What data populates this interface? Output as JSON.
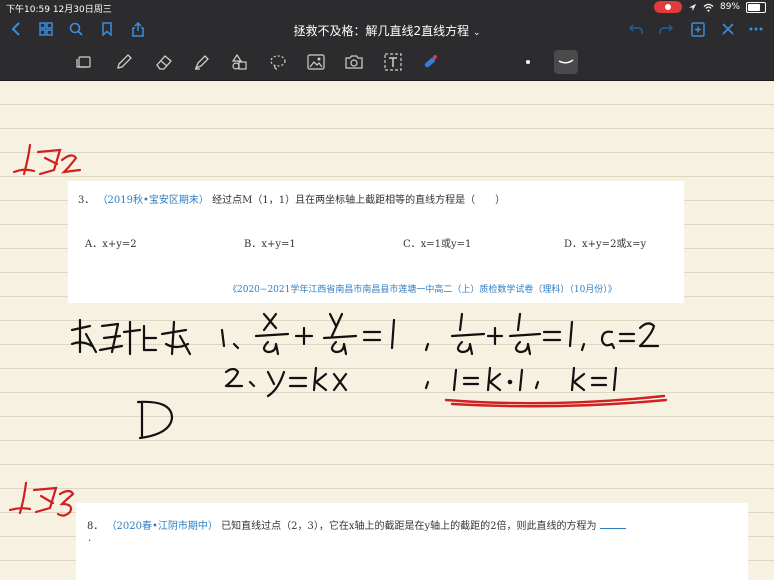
{
  "status_bar": {
    "time": "下午10:59",
    "date": "12月30日周三",
    "battery": "89%",
    "battery_level": 0.89
  },
  "nav": {
    "title": "拯救不及格：解几直线2直线方程",
    "icons": [
      "back-icon",
      "grid-icon",
      "search-icon",
      "bookmark-icon",
      "share-icon",
      "undo-icon",
      "redo-icon",
      "add-page-icon",
      "close-icon",
      "more-icon"
    ]
  },
  "toolbar": {
    "tools": [
      "read-mode-icon",
      "pen-icon",
      "eraser-icon",
      "highlighter-icon",
      "shapes-icon",
      "lasso-icon",
      "image-icon",
      "camera-icon",
      "text-icon",
      "laser-pointer-icon"
    ],
    "selected_tool": "stroke-width"
  },
  "question3": {
    "number": "3．",
    "source_tag": "（2019秋•宝安区期末）",
    "text": "经过点M（1，1）且在两坐标轴上截距相等的直线方程是（　　）",
    "options": {
      "a": "A．x+y=2",
      "b": "B．x+y=1",
      "c": "C．x=1或y=1",
      "d": "D．x+y=2或x=y"
    },
    "exam_source": "《2020−2021学年江西省南昌市南昌县市莲塘一中高二（上）质检数学试卷（理科）（10月份）》"
  },
  "question8": {
    "number": "8．",
    "source_tag": "（2020春•江阴市期中）",
    "text": "已知直线过点（2，3），它在x轴上的截距是在y轴上的截距的2倍，则此直线的方程为",
    "trailing": "."
  },
  "colors": {
    "ink": "#111111",
    "red_ink": "#d21f1f",
    "source_blue": "#2f7ec2",
    "paper": "#f6f1e1",
    "chrome": "#2c2c2e"
  }
}
